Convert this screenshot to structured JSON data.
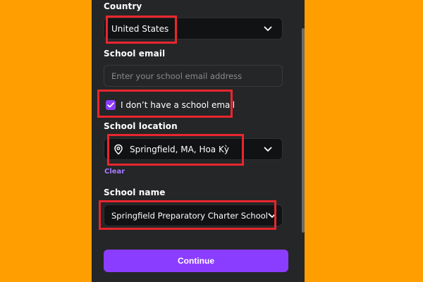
{
  "form": {
    "country": {
      "label": "Country",
      "value": "United States",
      "icon": "chevron-down-icon"
    },
    "school_email": {
      "label": "School email",
      "placeholder": "Enter your school email address"
    },
    "no_school_email": {
      "label": "I don’t have a school email",
      "checked": true
    },
    "school_location": {
      "label": "School location",
      "value": "Springfield, MA, Hoa Kỳ",
      "icon": "location-pin-icon",
      "clear_label": "Clear"
    },
    "school_name": {
      "label": "School name",
      "value": "Springfield Preparatory Charter School"
    },
    "continue_label": "Continue"
  },
  "colors": {
    "background": "#ff9e00",
    "panel": "#252627",
    "field": "#111214",
    "accent": "#8b3dff",
    "link": "#a57aff",
    "highlight": "#e8262e"
  }
}
